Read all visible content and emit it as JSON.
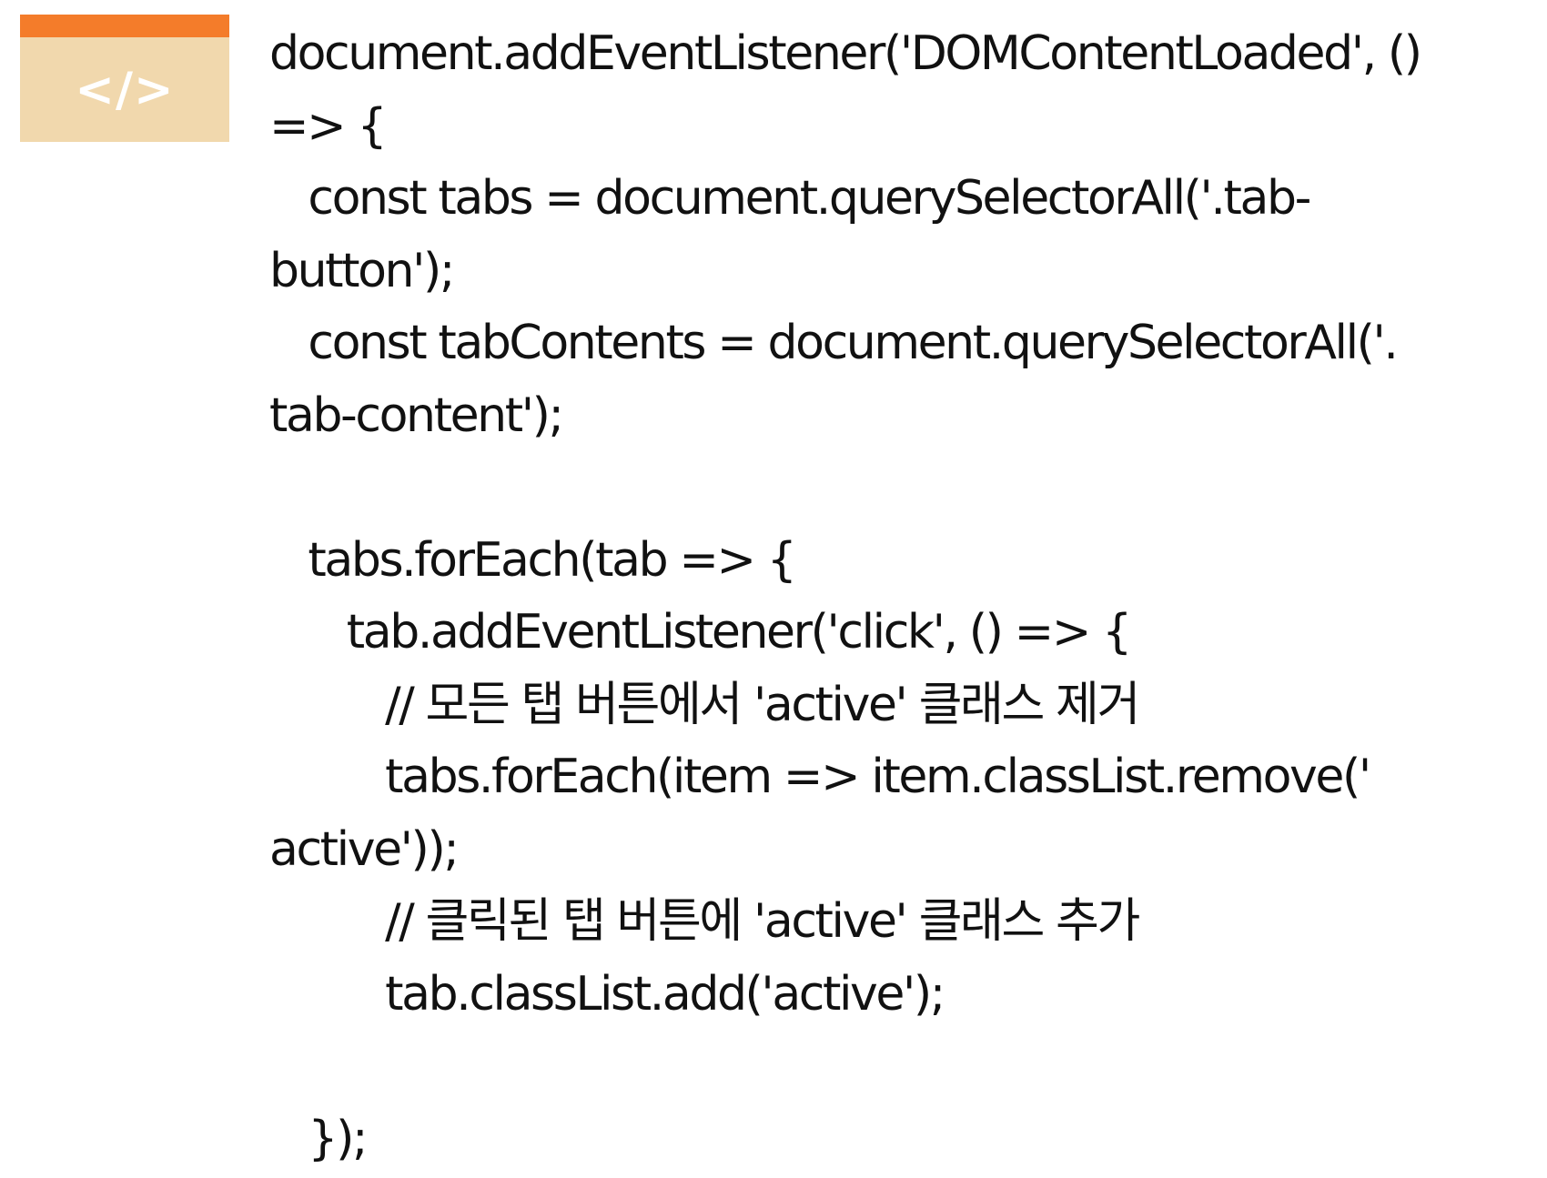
{
  "icon": {
    "name": "code-file-icon",
    "glyph": "</>",
    "colors": {
      "bar": "#f47c2a",
      "body": "#f1d8ad",
      "glyph": "#ffffff"
    }
  },
  "code": {
    "lines": [
      "document.addEventListener('DOMContentLoaded', ()",
      "=> {",
      "   const tabs = document.querySelectorAll('.tab-",
      "button');",
      "   const tabContents = document.querySelectorAll('.",
      "tab-content');",
      "",
      "   tabs.forEach(tab => {",
      "      tab.addEventListener('click', () => {",
      "         // 모든 탭 버튼에서 'active' 클래스 제거",
      "         tabs.forEach(item => item.classList.remove('",
      "active'));",
      "         // 클릭된 탭 버튼에 'active' 클래스 추가",
      "         tab.classList.add('active');",
      "",
      "   });"
    ]
  }
}
